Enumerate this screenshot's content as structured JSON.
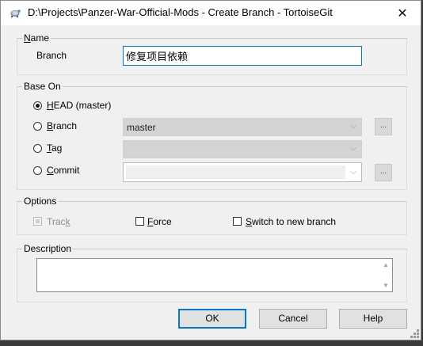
{
  "window": {
    "title": "D:\\Projects\\Panzer-War-Official-Mods - Create Branch - TortoiseGit",
    "close_symbol": "✕"
  },
  "name_group": {
    "label": "Name",
    "branch_label": "Branch",
    "branch_value": "修复项目依赖"
  },
  "base_on_group": {
    "label": "Base On",
    "head_label": "HEAD (master)",
    "branch_label": "Branch",
    "branch_combo_value": "master",
    "tag_label": "Tag",
    "tag_combo_value": "",
    "commit_label": "Commit",
    "commit_combo_value": "",
    "browse_label": "...",
    "selected": "HEAD (master)"
  },
  "options_group": {
    "label": "Options",
    "track_label": "Track",
    "force_label": "Force",
    "switch_label": "Switch to new branch",
    "track_checked": false,
    "track_disabled": true,
    "force_checked": false,
    "switch_checked": false
  },
  "description_group": {
    "label": "Description",
    "value": ""
  },
  "buttons": {
    "ok": "OK",
    "cancel": "Cancel",
    "help": "Help"
  }
}
